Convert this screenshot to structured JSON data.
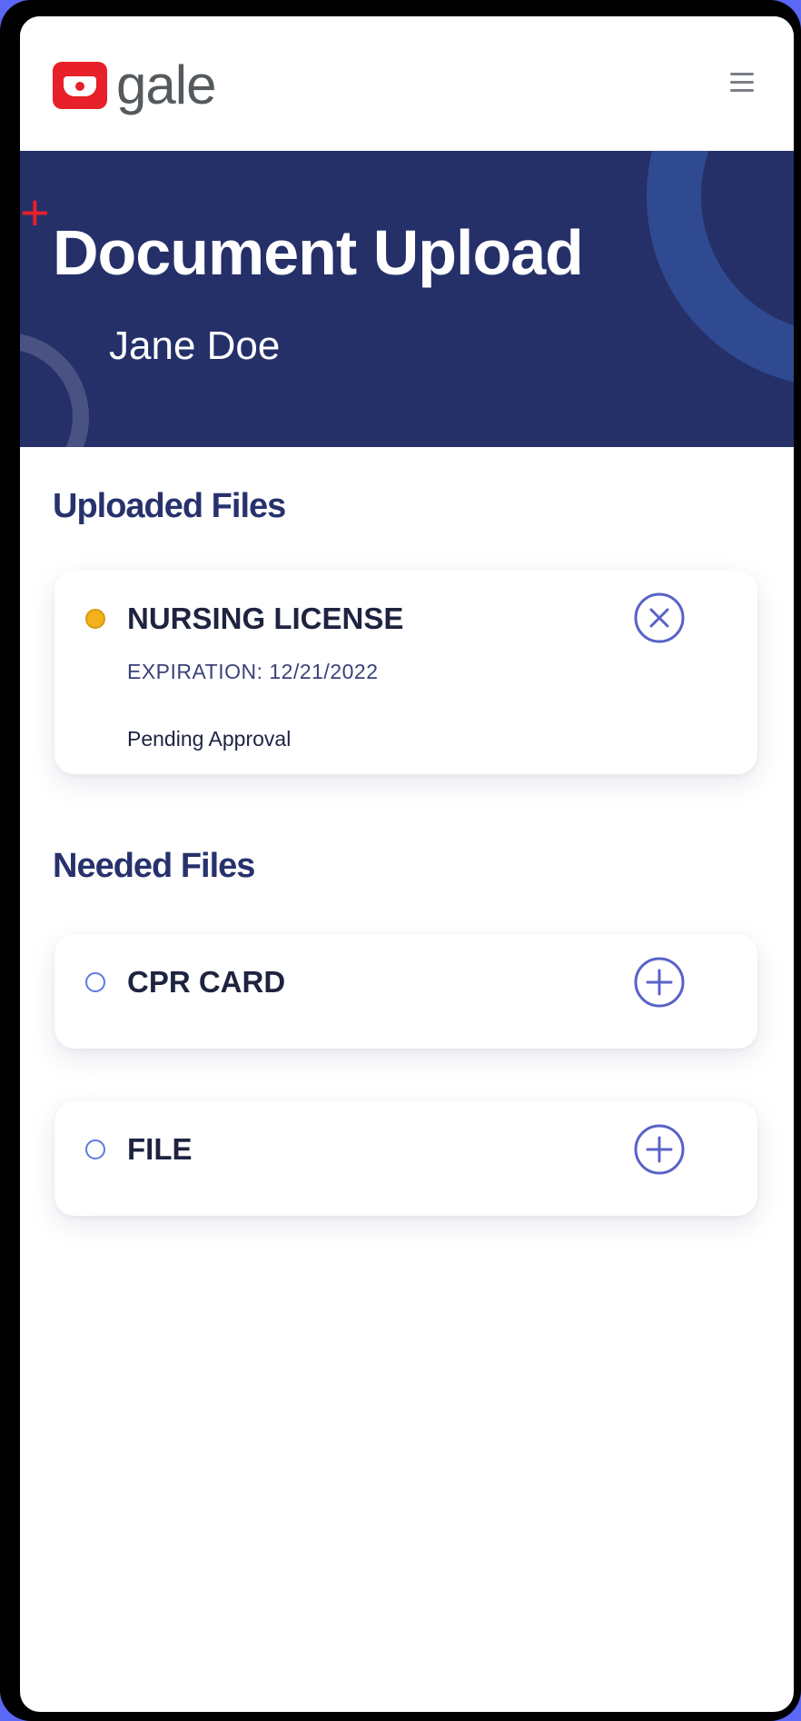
{
  "brand": {
    "name": "gale",
    "color": "#e8202a"
  },
  "header": {
    "menu_icon": "hamburger-menu-icon"
  },
  "hero": {
    "title": "Document Upload",
    "user_name": "Jane Doe",
    "background": "#253069"
  },
  "uploaded": {
    "heading": "Uploaded Files",
    "items": [
      {
        "name": "NURSING LICENSE",
        "expiration": "EXPIRATION: 12/21/2022",
        "status": "Pending Approval",
        "status_color": "#f3b21b",
        "action_icon": "remove-circle-icon"
      }
    ]
  },
  "needed": {
    "heading": "Needed Files",
    "items": [
      {
        "name": "CPR CARD",
        "action_icon": "add-circle-icon"
      },
      {
        "name": "FILE",
        "action_icon": "add-circle-icon"
      }
    ]
  },
  "accent": "#5a62c8"
}
